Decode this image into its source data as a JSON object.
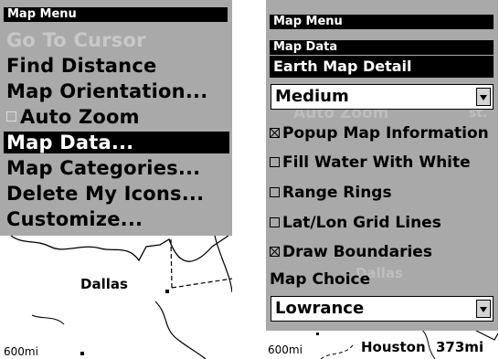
{
  "left": {
    "header": "Map Menu",
    "items": [
      {
        "label": "Go To Cursor",
        "disabled": true
      },
      {
        "label": "Find Distance"
      },
      {
        "label": "Map Orientation..."
      },
      {
        "label": "Auto Zoom",
        "checkbox": true,
        "checked": false
      },
      {
        "label": "Map Data...",
        "selected": true
      },
      {
        "label": "Map Categories..."
      },
      {
        "label": "Delete My Icons..."
      },
      {
        "label": "Customize..."
      }
    ],
    "map": {
      "city": "Dallas",
      "scale": "600mi"
    }
  },
  "right": {
    "header": "Map Menu",
    "dialog_title": "Map Data",
    "detail_label": "Earth Map Detail",
    "detail_value": "Medium",
    "options": [
      {
        "label": "Popup Map Information",
        "checked": true
      },
      {
        "label": "Fill Water With White",
        "checked": false
      },
      {
        "label": "Range Rings",
        "checked": false
      },
      {
        "label": "Lat/Lon Grid Lines",
        "checked": false
      },
      {
        "label": "Draw Boundaries",
        "checked": true
      }
    ],
    "map_choice_label": "Map Choice",
    "map_choice_value": "Lowrance",
    "bottom": {
      "scale": "600mi",
      "city": "Houston",
      "distance": "373mi"
    },
    "ghost": {
      "auto_zoom": "Auto Zoom",
      "dallas": "Dallas",
      "st": "st."
    }
  }
}
